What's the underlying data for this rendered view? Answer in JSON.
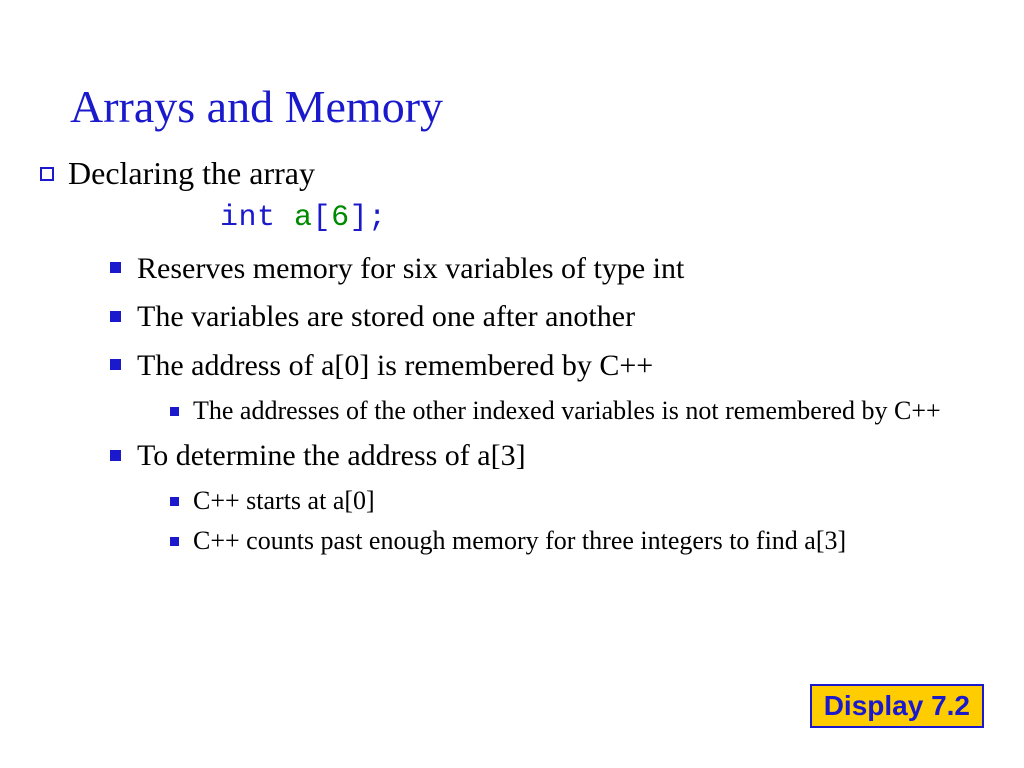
{
  "title": "Arrays and Memory",
  "level1": "Declaring the array",
  "code": {
    "kw": "int",
    "ident": "a",
    "lbrack": "[",
    "num": "6",
    "rbrack": "]",
    "semi": ";"
  },
  "points": {
    "p1": "Reserves memory for six variables of type int",
    "p2": "The variables are stored one after another",
    "p3": "The address of a[0] is remembered by C++",
    "p3a": "The addresses of the other indexed variables is not remembered by C++",
    "p4": "To determine the address of a[3]",
    "p4a": "C++ starts at a[0]",
    "p4b": "C++ counts past enough memory for three integers to find a[3]"
  },
  "badge": "Display 7.2"
}
